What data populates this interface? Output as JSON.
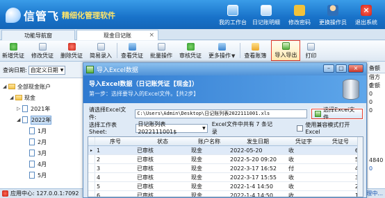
{
  "header": {
    "brand": "信管飞",
    "slogan": "精细化管理软件",
    "nav": [
      {
        "label": "我的工作台",
        "icon": "desktop-icon"
      },
      {
        "label": "日记账明细",
        "icon": "journal-icon"
      },
      {
        "label": "修改密码",
        "icon": "lock-icon"
      },
      {
        "label": "更换操作员",
        "icon": "user-icon"
      },
      {
        "label": "退出系统",
        "icon": "exit-icon"
      }
    ]
  },
  "tabs": {
    "nav": "功能导航窗",
    "journal": "现金日记账",
    "close": "×"
  },
  "toolbar": {
    "new": "新增凭证",
    "edit": "修改凭证",
    "delete": "删除凭证",
    "quick": "简易录入",
    "view": "查看凭证",
    "batch": "批量操作",
    "audit": "审核凭证",
    "more": "更多操作",
    "account_book": "查看账簿",
    "import_export": "导入导出",
    "print": "打印",
    "dropdown_glyph": "▼"
  },
  "query": {
    "label": "查询日期:",
    "value": "自定义日期"
  },
  "tree": {
    "root": "全部现金账户",
    "cash": "现金",
    "years": [
      "2021年",
      "2022年"
    ],
    "months": [
      "1月",
      "2月",
      "3月",
      "4月",
      "5月"
    ]
  },
  "right_strip": {
    "header": "备额",
    "rows": [
      "借方金额",
      "0",
      "0",
      "0",
      "0",
      "",
      "",
      "",
      "",
      "",
      "4840",
      "0"
    ]
  },
  "status": {
    "text": "应用中心: 127.0.0.1:7092",
    "link": "管理中..."
  },
  "dialog": {
    "title": "导入Excel数据",
    "controls": [
      "–",
      "□",
      "×"
    ],
    "banner_title": "导入Excel数据（日记账凭证【现金】）",
    "banner_step": "第一步：选择要导入的Excel文件。【共2步】",
    "file_label": "请选择Excel文件:",
    "file_path": "C:\\Users\\Admin\\Desktop\\日记账列表2022111001.xls",
    "choose_button": "选择Excel文件",
    "sheet_label": "选择工作表Sheet:",
    "sheet_value": "日记账列表2022111001$",
    "sheet_info": "Excel文件中共有 7 条记录",
    "compat_label": "使用兼容模式打开Excel",
    "columns": [
      "序号",
      "状态",
      "账户名称",
      "发生日期",
      "凭证字",
      "凭证号"
    ],
    "rows": [
      {
        "marker": "▸",
        "no": "1",
        "status": "已审核",
        "account": "现金",
        "date": "2022-05-20",
        "word": "收",
        "num": "6"
      },
      {
        "marker": "",
        "no": "2",
        "status": "已审核",
        "account": "现金",
        "date": "2022-5-20 09:20",
        "word": "收",
        "num": "5"
      },
      {
        "marker": "",
        "no": "3",
        "status": "已审核",
        "account": "现金",
        "date": "2022-3-17 16:52",
        "word": "付",
        "num": "4"
      },
      {
        "marker": "",
        "no": "4",
        "status": "已审核",
        "account": "现金",
        "date": "2022-3-17 15:55",
        "word": "收",
        "num": "3"
      },
      {
        "marker": "",
        "no": "5",
        "status": "已审核",
        "account": "现金",
        "date": "2022-1-4 14:50",
        "word": "收",
        "num": "2"
      },
      {
        "marker": "",
        "no": "6",
        "status": "已审核",
        "account": "现金",
        "date": "2022-1-4 14:50",
        "word": "收",
        "num": "1"
      }
    ]
  },
  "colors": {
    "header_blue": "#1872c9",
    "slogan_yellow": "#ffe56a",
    "highlight_red": "#e33d2d"
  }
}
